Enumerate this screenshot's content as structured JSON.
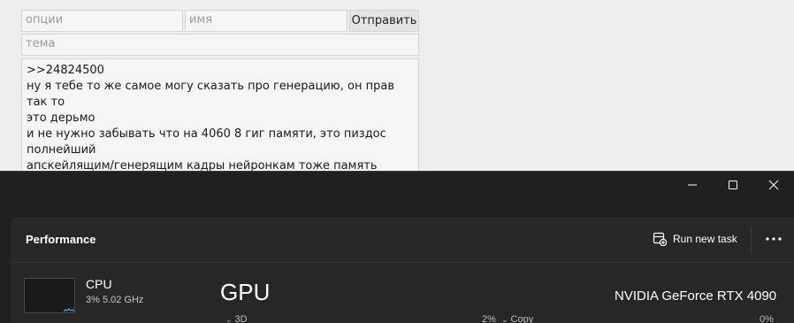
{
  "form": {
    "options_placeholder": "опции",
    "name_placeholder": "имя",
    "submit_label": "Отправить",
    "subject_placeholder": "тема",
    "message": ">>24824500\nну я тебе то же самое могу сказать про генерацию, он прав так то\nэто дерьмо\nи не нужно забывать что на 4060 8 гиг памяти, это пиздос полнейший\nапскейлящим/генерящим кадры нейронкам тоже память нужна, это\nлютый прогрев"
  },
  "task_manager": {
    "header": {
      "title": "Performance",
      "run_new_task": "Run new task"
    },
    "cpu": {
      "name": "CPU",
      "stats": "3%  5.02 GHz"
    },
    "gpu": {
      "heading": "GPU",
      "model": "NVIDIA GeForce RTX 4090",
      "engines": [
        {
          "label": "3D",
          "value": "2%"
        },
        {
          "label": "Copy",
          "value": "0%"
        }
      ]
    }
  },
  "colors": {
    "form_bg": "#eeeeee",
    "tm_bg": "#202020",
    "tm_panel": "#272727",
    "accent": "#4cc2ff"
  },
  "icons": [
    "minimize-icon",
    "maximize-icon",
    "close-icon",
    "run-task-icon",
    "more-icon",
    "chevron-down-icon"
  ]
}
